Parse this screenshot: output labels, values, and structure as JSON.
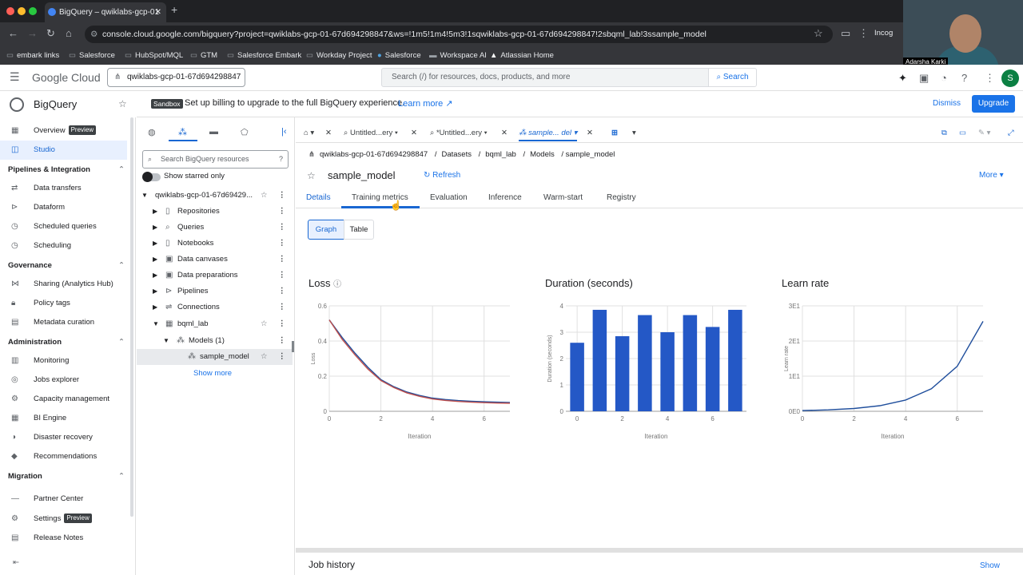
{
  "browser": {
    "tab_title": "BigQuery – qwiklabs-gcp-01",
    "url": "console.cloud.google.com/bigquery?project=qwiklabs-gcp-01-67d694298847&ws=!1m5!1m4!5m3!1sqwiklabs-gcp-01-67d694298847!2sbqml_lab!3ssample_model",
    "incognito_label": "Incog",
    "bookmarks": [
      "embark links",
      "Salesforce",
      "HubSpot/MQL",
      "GTM",
      "Salesforce Embark",
      "Workday Project",
      "Salesforce",
      "Workspace AI",
      "Atlassian Home"
    ]
  },
  "video": {
    "name": "Adarsha Karki"
  },
  "header": {
    "logo_text": "Google Cloud",
    "project": "qwiklabs-gcp-01-67d694298847",
    "search_placeholder": "Search (/) for resources, docs, products, and more",
    "search_button": "Search",
    "avatar_letter": "S"
  },
  "product": {
    "name": "BigQuery"
  },
  "banner": {
    "badge": "Sandbox",
    "text": "Set up billing to upgrade to the full BigQuery experience.",
    "link": "Learn more",
    "dismiss": "Dismiss",
    "upgrade": "Upgrade"
  },
  "nav": {
    "overview": "Overview",
    "overview_badge": "Preview",
    "studio": "Studio",
    "sec_pipelines": "Pipelines & Integration",
    "data_transfers": "Data transfers",
    "dataform": "Dataform",
    "scheduled_queries": "Scheduled queries",
    "scheduling": "Scheduling",
    "sec_governance": "Governance",
    "sharing": "Sharing (Analytics Hub)",
    "policy_tags": "Policy tags",
    "metadata": "Metadata curation",
    "sec_admin": "Administration",
    "monitoring": "Monitoring",
    "jobs_explorer": "Jobs explorer",
    "capacity": "Capacity management",
    "bi_engine": "BI Engine",
    "disaster": "Disaster recovery",
    "recommendations": "Recommendations",
    "sec_migration": "Migration",
    "partner_center": "Partner Center",
    "settings": "Settings",
    "settings_badge": "Preview",
    "release_notes": "Release Notes"
  },
  "explorer": {
    "search_placeholder": "Search BigQuery resources",
    "starred_label": "Show starred only",
    "project": "qwiklabs-gcp-01-67d69429...",
    "items": [
      "Repositories",
      "Queries",
      "Notebooks",
      "Data canvases",
      "Data preparations",
      "Pipelines",
      "Connections"
    ],
    "dataset": "bqml_lab",
    "models": "Models (1)",
    "model": "sample_model",
    "show_more": "Show more"
  },
  "workspace": {
    "tabs": [
      "Untitled...ery",
      "*Untitled...ery",
      "sample... del"
    ]
  },
  "breadcrumb": [
    "qwiklabs-gcp-01-67d694298847",
    "Datasets",
    "bqml_lab",
    "Models",
    "/ sample_model"
  ],
  "model": {
    "name": "sample_model",
    "refresh": "Refresh",
    "more": "More"
  },
  "detail_tabs": [
    "Details",
    "Training metrics",
    "Evaluation",
    "Inference",
    "Warm-start",
    "Registry"
  ],
  "view_toggle": {
    "graph": "Graph",
    "table": "Table"
  },
  "job_history": {
    "title": "Job history",
    "show": "Show"
  },
  "chart_data": [
    {
      "type": "line",
      "title": "Loss",
      "xlabel": "Iteration",
      "ylabel": "Loss",
      "xlim": [
        0,
        7
      ],
      "ylim": [
        0,
        0.6
      ],
      "xticks": [
        "0",
        "2",
        "4",
        "6"
      ],
      "yticks": [
        "0",
        "0.2",
        "0.4",
        "0.6"
      ],
      "grid": true,
      "series": [
        {
          "color": "#1f4e9c",
          "x": [
            0,
            0.5,
            1,
            1.5,
            2,
            2.5,
            3,
            3.5,
            4,
            4.5,
            5,
            5.5,
            6,
            6.5,
            7
          ],
          "y": [
            0.52,
            0.42,
            0.33,
            0.25,
            0.18,
            0.14,
            0.11,
            0.09,
            0.075,
            0.067,
            0.061,
            0.057,
            0.054,
            0.052,
            0.05
          ]
        },
        {
          "color": "#c0504d",
          "x": [
            0,
            0.5,
            1,
            1.5,
            2,
            2.5,
            3,
            3.5,
            4,
            4.5,
            5,
            5.5,
            6,
            6.5,
            7
          ],
          "y": [
            0.52,
            0.41,
            0.32,
            0.24,
            0.175,
            0.135,
            0.105,
            0.085,
            0.07,
            0.062,
            0.056,
            0.052,
            0.049,
            0.047,
            0.046
          ]
        }
      ]
    },
    {
      "type": "bar",
      "title": "Duration (seconds)",
      "xlabel": "Iteration",
      "ylabel": "Duration (seconds)",
      "categories": [
        "0",
        "1",
        "2",
        "3",
        "4",
        "5",
        "6",
        "7"
      ],
      "xticks": [
        "0",
        "2",
        "4",
        "6"
      ],
      "values": [
        2.6,
        3.85,
        2.85,
        3.65,
        3.0,
        3.65,
        3.2,
        3.85
      ],
      "ylim": [
        0,
        4
      ],
      "yticks": [
        "0",
        "1",
        "2",
        "3",
        "4"
      ],
      "color": "#2458c6",
      "grid": true
    },
    {
      "type": "line",
      "title": "Learn rate",
      "xlabel": "Iteration",
      "ylabel": "Learn rate",
      "xlim": [
        0,
        7
      ],
      "ylim": [
        0,
        30
      ],
      "xticks": [
        "0",
        "2",
        "4",
        "6"
      ],
      "yticks": [
        "0E0",
        "1E1",
        "2E1",
        "3E1"
      ],
      "grid": true,
      "series": [
        {
          "color": "#1f4e9c",
          "x": [
            0,
            1,
            2,
            3,
            4,
            5,
            6,
            7
          ],
          "y": [
            0.2,
            0.4,
            0.8,
            1.6,
            3.2,
            6.4,
            12.8,
            25.6
          ]
        }
      ]
    }
  ]
}
